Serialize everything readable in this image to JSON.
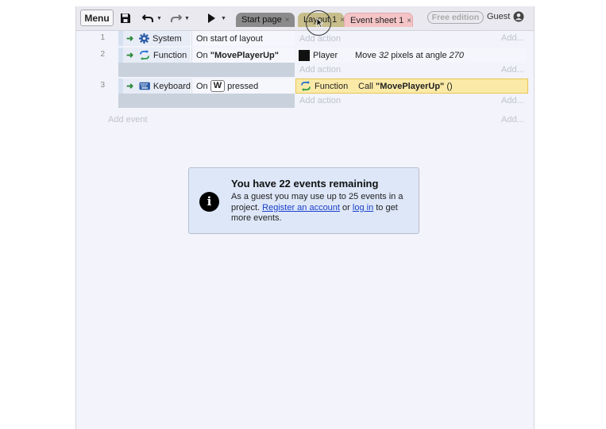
{
  "toolbar": {
    "menu_label": "Menu",
    "tabs": [
      {
        "label": "Start page",
        "close": "×"
      },
      {
        "label": "Layout 1",
        "close": "×"
      },
      {
        "label": "Event sheet 1",
        "close": "×"
      }
    ],
    "badge": "Free edition",
    "user": "Guest",
    "icons": [
      "save-icon",
      "undo-icon",
      "redo-icon",
      "play-icon",
      "user-icon"
    ]
  },
  "events": [
    {
      "num": "1",
      "condition": {
        "object": "System",
        "icon": "gear-icon",
        "pre": "",
        "key": "",
        "text": "On start of layout"
      },
      "actions": [],
      "add_action": "Add action",
      "add_right": "Add..."
    },
    {
      "num": "2",
      "condition": {
        "object": "Function",
        "icon": "function-icon",
        "pre": "On ",
        "key": "",
        "text": "\"MovePlayerUp\""
      },
      "actions": [
        {
          "object": "Player",
          "text_pre": "Move ",
          "value1": "32",
          "text_mid": " pixels at angle ",
          "value2": "270"
        }
      ],
      "add_action": "Add action",
      "add_right": "Add..."
    },
    {
      "num": "3",
      "condition": {
        "object": "Keyboard",
        "icon": "keyboard-icon",
        "pre": "On",
        "key": "W",
        "text": "pressed"
      },
      "actions": [
        {
          "object": "Function",
          "text_pre": "Call ",
          "value1": "\"MovePlayerUp\"",
          "text_mid": " ()"
        }
      ],
      "add_action": "Add action",
      "add_right": "Add..."
    }
  ],
  "add_event": "Add event",
  "add_event_right": "Add...",
  "notice": {
    "icon": "i",
    "title": "You have 22 events remaining",
    "body_pre": "As a guest you may use up to 25 events in a project. ",
    "link1": "Register an account",
    "body_mid": " or ",
    "link2": "log in",
    "body_post": " to get more events."
  },
  "colors": {
    "accent": "#2c8a3a",
    "highlight": "#fbeaa7",
    "notice_bg": "#dde7f8"
  }
}
